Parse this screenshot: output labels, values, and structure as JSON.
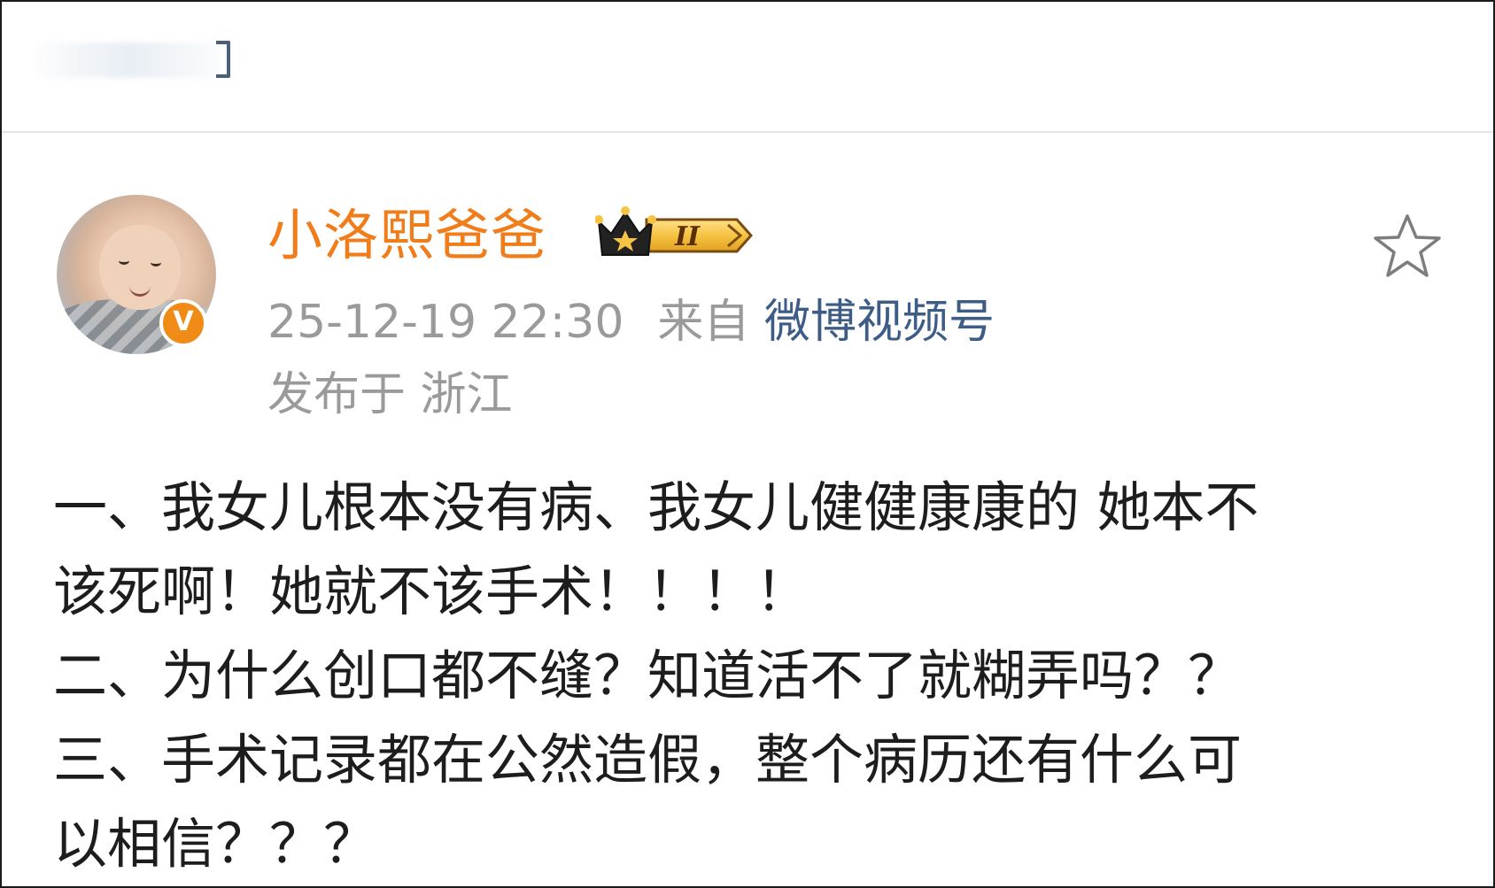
{
  "post": {
    "username": "小洛熙爸爸",
    "timestamp": "25-12-19 22:30",
    "source_prefix": "来自",
    "source_app": "微博视频号",
    "location": "发布于 浙江",
    "vip_level": "II",
    "verified_mark": "V",
    "body_lines": [
      "一、我女儿根本没有病、我女儿健健康康的 她本不",
      "该死啊！她就不该手术！！！！",
      "二、为什么创口都不缝？知道活不了就糊弄吗？？",
      "三、手术记录都在公然造假，整个病历还有什么可",
      "以相信？？？"
    ]
  },
  "icons": {
    "favorite": "star-outline-icon",
    "back": "back-bracket-icon",
    "verified": "verified-v-badge-icon",
    "vip": "crown-vip-badge-icon"
  },
  "colors": {
    "username": "#f07c1a",
    "meta": "#9a9a9a",
    "source_link": "#3d5c86",
    "body_text": "#1d1d1d",
    "verified_badge": "#f08b17",
    "vip_gold": "#f6c343"
  }
}
